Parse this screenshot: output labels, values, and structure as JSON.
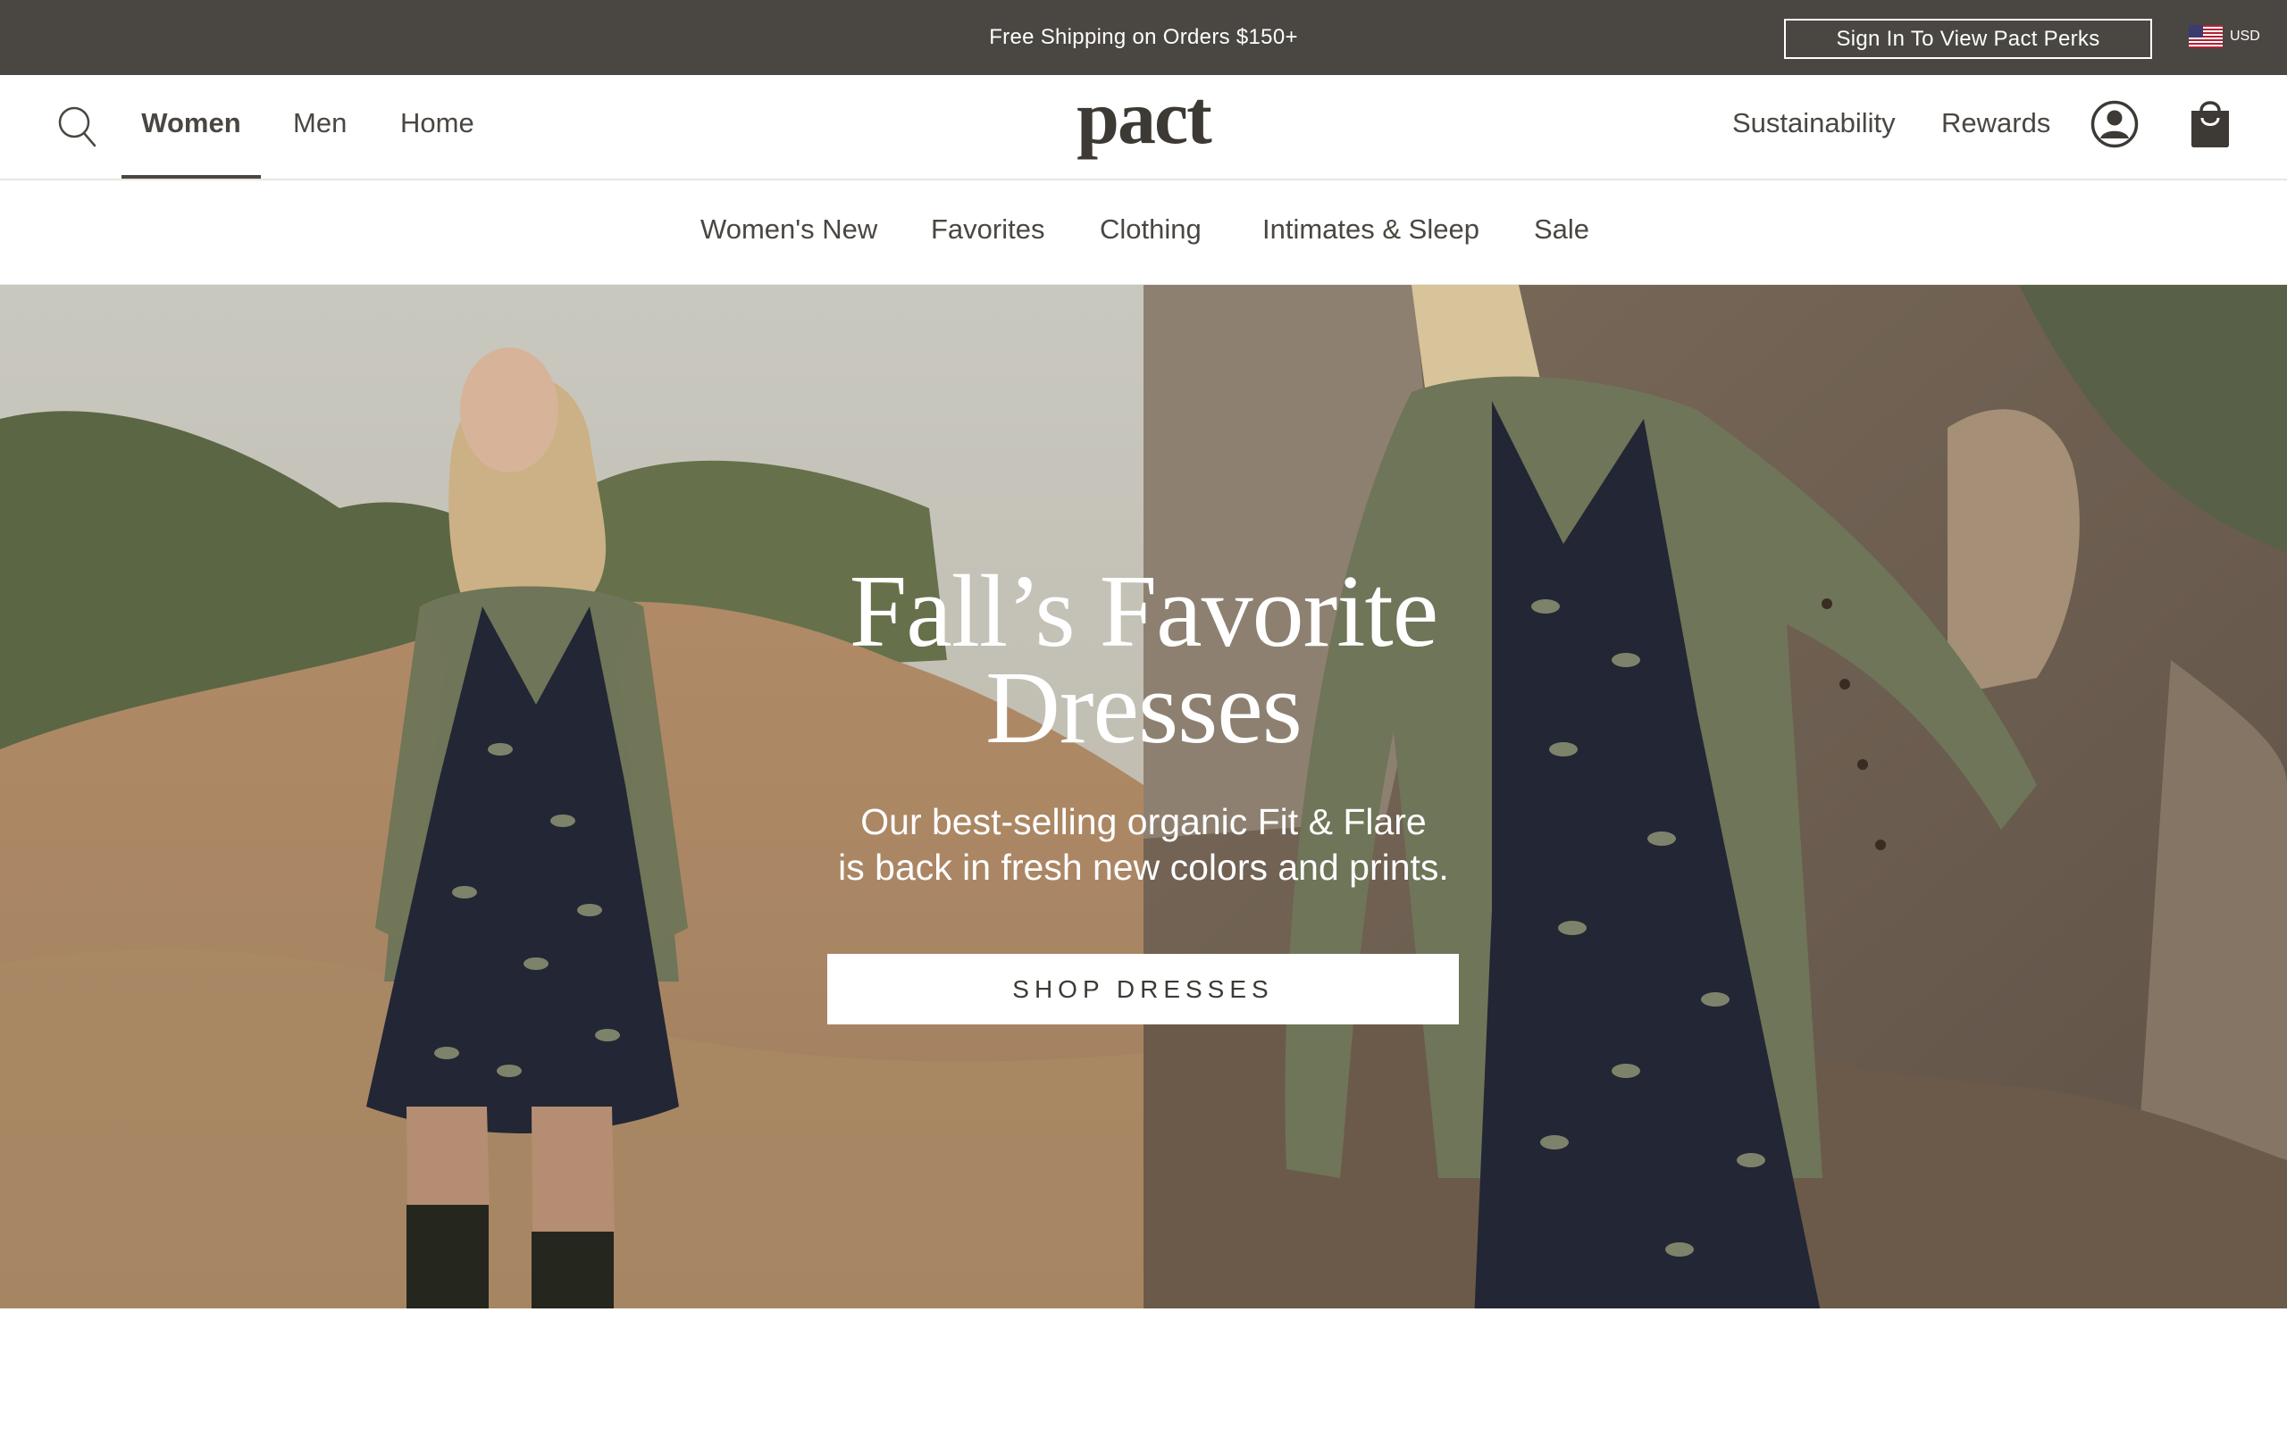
{
  "announcement": {
    "text": "Free Shipping on Orders $150+",
    "perks_button": "Sign In To View Pact Perks",
    "currency": "USD",
    "flag_icon": "us-flag-icon"
  },
  "main_nav": {
    "logo_text": "pact",
    "search_icon": "search-icon",
    "departments": [
      "Women",
      "Men",
      "Home"
    ],
    "active_department": "Women",
    "right_links": [
      "Sustainability",
      "Rewards"
    ],
    "account_icon": "user-circle-icon",
    "cart_icon": "shopping-bag-icon"
  },
  "sub_nav": {
    "items": [
      "Women's New",
      "Favorites",
      "Clothing",
      "Intimates & Sleep",
      "Sale"
    ]
  },
  "hero": {
    "title_line1": "Fall’s Favorite",
    "title_line2": "Dresses",
    "subtitle_line1": "Our best-selling organic Fit & Flare",
    "subtitle_line2": "is back in fresh new colors and prints.",
    "cta": "SHOP DRESSES"
  },
  "colors": {
    "announcement_bg": "#4a4641",
    "text_dark": "#4a4641",
    "white": "#ffffff"
  }
}
